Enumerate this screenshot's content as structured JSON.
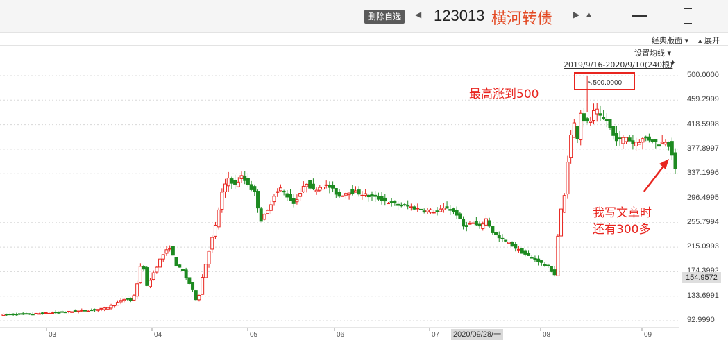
{
  "header": {
    "delete_button": "删除自选",
    "prev_icon": "triangle-left-icon",
    "next_icon": "triangle-right-icon",
    "code": "123013",
    "name": "横河转债",
    "bell_icon": "bell-icon",
    "minimize_icon": "minimize-icon",
    "maximize_icon": "maximize-icon"
  },
  "toolbar": {
    "classic_layout": "经典版面",
    "classic_icon": "dropdown-icon",
    "expand": "展开",
    "expand_icon": "chevron-up-icon",
    "set_ma": "设置均线",
    "set_ma_icon": "dropdown-icon",
    "range": "2019/9/16-2020/9/10(240根)",
    "pin_icon": "pin-icon"
  },
  "price_tag": "154.9572",
  "crosshair_date": "2020/09/28/一",
  "max_label": "↖500.0000",
  "annotations": {
    "high": "最高涨到500",
    "note_line1": "我写文章时",
    "note_line2": "还有300多"
  },
  "colors": {
    "up": "#e8251f",
    "down": "#1d8a21",
    "annotation": "#e8251f",
    "grid": "#d8d8d8"
  },
  "chart_data": {
    "type": "candlestick",
    "title": "",
    "y_ticks": [
      "500.0000",
      "459.2999",
      "418.5998",
      "377.8997",
      "337.1996",
      "296.4995",
      "255.7994",
      "215.0993",
      "174.3992",
      "133.6991",
      "92.9990"
    ],
    "ylim": [
      92.999,
      500.0
    ],
    "x_ticks": [
      "03",
      "04",
      "05",
      "06",
      "07",
      "08",
      "09"
    ],
    "grid": true,
    "series": [
      {
        "close_path": [
          {
            "x": 0,
            "c": 103
          },
          {
            "x": 18,
            "c": 104
          },
          {
            "x": 36,
            "c": 107
          },
          {
            "x": 52,
            "c": 110
          },
          {
            "x": 62,
            "c": 113
          },
          {
            "x": 68,
            "c": 120
          },
          {
            "x": 75,
            "c": 130
          },
          {
            "x": 79,
            "c": 125
          },
          {
            "x": 82,
            "c": 155
          },
          {
            "x": 85,
            "c": 195
          },
          {
            "x": 88,
            "c": 150
          },
          {
            "x": 93,
            "c": 178
          },
          {
            "x": 97,
            "c": 200
          },
          {
            "x": 102,
            "c": 215
          },
          {
            "x": 106,
            "c": 185
          },
          {
            "x": 110,
            "c": 175
          },
          {
            "x": 115,
            "c": 150
          },
          {
            "x": 119,
            "c": 122
          },
          {
            "x": 122,
            "c": 165
          },
          {
            "x": 126,
            "c": 210
          },
          {
            "x": 130,
            "c": 250
          },
          {
            "x": 134,
            "c": 305
          },
          {
            "x": 138,
            "c": 330
          },
          {
            "x": 142,
            "c": 318
          },
          {
            "x": 146,
            "c": 332
          },
          {
            "x": 150,
            "c": 320
          },
          {
            "x": 154,
            "c": 305
          },
          {
            "x": 158,
            "c": 260
          },
          {
            "x": 162,
            "c": 275
          },
          {
            "x": 166,
            "c": 302
          },
          {
            "x": 170,
            "c": 312
          },
          {
            "x": 174,
            "c": 300
          },
          {
            "x": 178,
            "c": 288
          },
          {
            "x": 182,
            "c": 305
          },
          {
            "x": 186,
            "c": 322
          },
          {
            "x": 190,
            "c": 310
          },
          {
            "x": 196,
            "c": 318
          },
          {
            "x": 200,
            "c": 315
          },
          {
            "x": 206,
            "c": 300
          },
          {
            "x": 212,
            "c": 308
          },
          {
            "x": 218,
            "c": 305
          },
          {
            "x": 224,
            "c": 300
          },
          {
            "x": 230,
            "c": 296
          },
          {
            "x": 236,
            "c": 290
          },
          {
            "x": 242,
            "c": 285
          },
          {
            "x": 248,
            "c": 283
          },
          {
            "x": 254,
            "c": 279
          },
          {
            "x": 260,
            "c": 276
          },
          {
            "x": 266,
            "c": 274
          },
          {
            "x": 272,
            "c": 281
          },
          {
            "x": 278,
            "c": 270
          },
          {
            "x": 282,
            "c": 250
          },
          {
            "x": 288,
            "c": 255
          },
          {
            "x": 292,
            "c": 248
          },
          {
            "x": 296,
            "c": 262
          },
          {
            "x": 300,
            "c": 240
          },
          {
            "x": 304,
            "c": 230
          },
          {
            "x": 310,
            "c": 222
          },
          {
            "x": 316,
            "c": 210
          },
          {
            "x": 322,
            "c": 200
          },
          {
            "x": 328,
            "c": 192
          },
          {
            "x": 334,
            "c": 182
          },
          {
            "x": 338,
            "c": 170
          },
          {
            "x": 341,
            "c": 265
          },
          {
            "x": 344,
            "c": 300
          },
          {
            "x": 347,
            "c": 390
          },
          {
            "x": 350,
            "c": 420
          },
          {
            "x": 352,
            "c": 398
          },
          {
            "x": 354,
            "c": 440
          },
          {
            "x": 357,
            "c": 420
          },
          {
            "x": 360,
            "c": 425
          },
          {
            "x": 363,
            "c": 445
          },
          {
            "x": 366,
            "c": 430
          },
          {
            "x": 370,
            "c": 425
          },
          {
            "x": 374,
            "c": 400
          },
          {
            "x": 378,
            "c": 392
          },
          {
            "x": 382,
            "c": 398
          },
          {
            "x": 386,
            "c": 388
          },
          {
            "x": 390,
            "c": 392
          },
          {
            "x": 394,
            "c": 396
          },
          {
            "x": 398,
            "c": 393
          },
          {
            "x": 402,
            "c": 386
          },
          {
            "x": 406,
            "c": 392
          },
          {
            "x": 409,
            "c": 383
          },
          {
            "x": 412,
            "c": 345
          }
        ]
      }
    ],
    "last_close": 154.9572,
    "max_value": 500.0
  }
}
